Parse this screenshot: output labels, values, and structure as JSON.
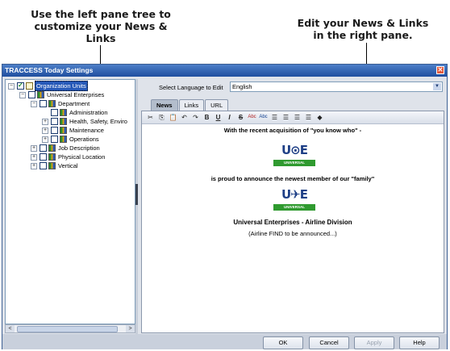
{
  "callouts": {
    "left": "Use the left pane tree to customize your News & Links",
    "right": "Edit your News & Links in the right pane."
  },
  "window": {
    "title": "TRACCESS Today Settings",
    "close_glyph": "✕"
  },
  "tree": {
    "items": [
      {
        "label": "Organization Units",
        "expander": "−",
        "checked": true
      },
      {
        "label": "Universal Enterprises",
        "expander": "−"
      },
      {
        "label": "Department",
        "expander": "−"
      },
      {
        "label": "Administration",
        "expander": ""
      },
      {
        "label": "Health, Safety, Enviro",
        "expander": "+"
      },
      {
        "label": "Maintenance",
        "expander": "+"
      },
      {
        "label": "Operations",
        "expander": "+"
      },
      {
        "label": "Job Description",
        "expander": "+"
      },
      {
        "label": "Physical Location",
        "expander": "+"
      },
      {
        "label": "Vertical",
        "expander": "+"
      }
    ],
    "scroll_left": "<",
    "scroll_right": ">"
  },
  "language": {
    "label": "Select Language to Edit",
    "value": "English"
  },
  "tabs": [
    {
      "label": "News",
      "active": true
    },
    {
      "label": "Links"
    },
    {
      "label": "URL"
    }
  ],
  "toolbar": {
    "tools": [
      "✂",
      "⎘",
      "📋",
      "↶",
      "↷",
      "B",
      "U",
      "I",
      "S",
      "Abc",
      "Abc",
      "☰",
      "☰",
      "☰",
      "☰",
      "◆"
    ]
  },
  "document": {
    "line1": "With the recent acquisition of \"you know who\" -",
    "logo1_band": "UNIVERSAL ENTERPRISES",
    "line2": "is proud to announce the newest member of our \"family\"",
    "logo2_band": "UNIVERSAL ENTERPRISES",
    "line3": "Universal Enterprises - Airline Division",
    "line4": "(Airline FIND to be announced...)"
  },
  "buttons": {
    "ok": "OK",
    "cancel": "Cancel",
    "apply": "Apply",
    "help": "Help"
  },
  "colors": {
    "title_bar": "#1f4e9f",
    "selection": "#2659b8",
    "logo_green": "#2f9a2f",
    "logo_blue": "#1e3f86"
  }
}
